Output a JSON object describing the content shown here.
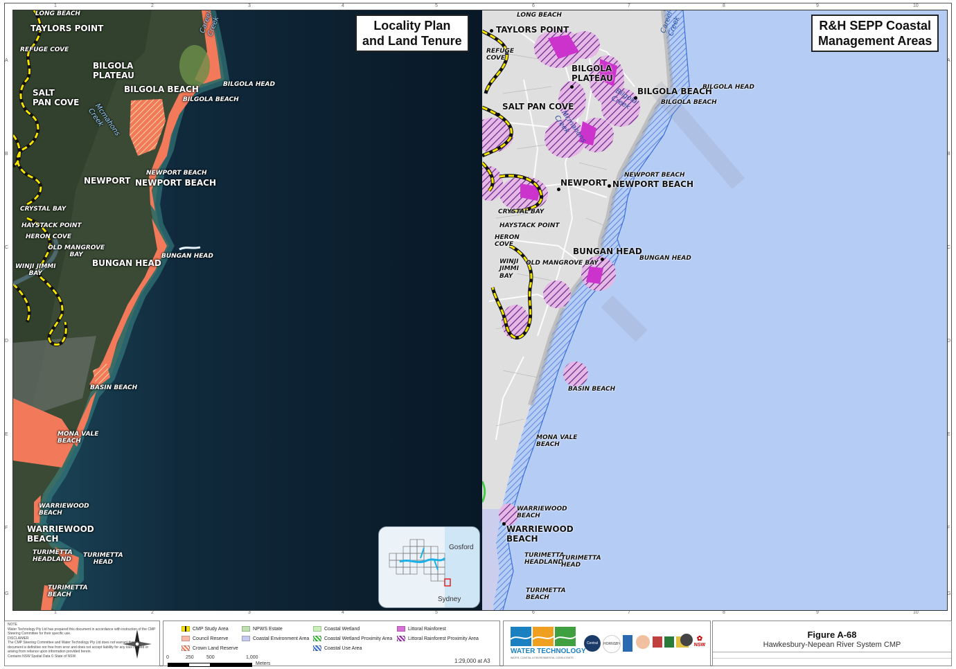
{
  "left_map": {
    "title_line1": "Locality Plan",
    "title_line2": "and Land Tenure",
    "labels": {
      "long_beach": "LONG BEACH",
      "taylors_point": "TAYLORS POINT",
      "refuge_cove": "REFUGE COVE",
      "bilgola_plateau_1": "BILGOLA",
      "bilgola_plateau_2": "PLATEAU",
      "bilgola_beach_big": "BILGOLA BEACH",
      "bilgola_head": "BILGOLA HEAD",
      "bilgola_beach_small": "BILGOLA BEACH",
      "salt_1": "SALT",
      "salt_2": "PAN COVE",
      "mcmahons_1": "Mcmahons",
      "mcmahons_2": "Creek",
      "careel_1": "Careel",
      "careel_2": "Creek",
      "newport_beach_small": "NEWPORT BEACH",
      "newport": "NEWPORT",
      "newport_beach_big": "NEWPORT BEACH",
      "crystal_bay": "CRYSTAL BAY",
      "haystack_point": "HAYSTACK POINT",
      "heron_cove": "HERON COVE",
      "old_mangrove_1": "OLD MANGROVE",
      "old_mangrove_2": "BAY",
      "winji_1": "WINJI JIMMI",
      "winji_2": "BAY",
      "bungan_head_big": "BUNGAN HEAD",
      "bungan_head_small": "BUNGAN HEAD",
      "basin_beach": "BASIN BEACH",
      "mona_vale_1": "MONA VALE",
      "mona_vale_2": "BEACH",
      "warriewood_small_1": "WARRIEWOOD",
      "warriewood_small_2": "BEACH",
      "warriewood_big_1": "WARRIEWOOD",
      "warriewood_big_2": "BEACH",
      "turimetta_headland_1": "TURIMETTA",
      "turimetta_headland_2": "HEADLAND",
      "turimetta_head_1": "TURIMETTA",
      "turimetta_head_2": "HEAD",
      "turimetta_beach_1": "TURIMETTA",
      "turimetta_beach_2": "BEACH"
    },
    "inset": {
      "gosford": "Gosford",
      "sydney": "Sydney"
    }
  },
  "right_map": {
    "title_line1": "R&H SEPP Coastal",
    "title_line2": "Management Areas",
    "labels": {
      "long_beach": "LONG BEACH",
      "taylors_point": "TAYLORS POINT",
      "refuge_1": "REFUGE",
      "refuge_2": "COVE",
      "bilgola_plateau_1": "BILGOLA",
      "bilgola_plateau_2": "PLATEAU",
      "bilgola_beach_big": "BILGOLA BEACH",
      "bilgola_head": "BILGOLA HEAD",
      "bilgola_beach_small": "BILGOLA BEACH",
      "salt_pan_cove": "SALT PAN COVE",
      "mcmahons_1": "Mcmahons",
      "mcmahons_2": "Creek",
      "bilgola_creek_1": "Bilgola",
      "bilgola_creek_2": "Creek",
      "careel_1": "Careel",
      "careel_2": "Creek",
      "newport": "NEWPORT",
      "newport_beach_big": "NEWPORT BEACH",
      "newport_beach_small": "NEWPORT BEACH",
      "crystal_bay": "CRYSTAL BAY",
      "haystack_point": "HAYSTACK POINT",
      "heron_1": "HERON",
      "heron_2": "COVE",
      "winji_1": "WINJI",
      "winji_2": "JIMMI",
      "winji_3": "BAY",
      "old_mangrove_bay": "OLD MANGROVE BAY",
      "bungan_head_big": "BUNGAN HEAD",
      "bungan_head_small": "BUNGAN HEAD",
      "basin_beach": "BASIN BEACH",
      "mona_vale_1": "MONA VALE",
      "mona_vale_2": "BEACH",
      "warriewood_small_1": "WARRIEWOOD",
      "warriewood_small_2": "BEACH",
      "warriewood_big_1": "WARRIEWOOD",
      "warriewood_big_2": "BEACH",
      "turimetta_headland_1": "TURIMETTA",
      "turimetta_headland_2": "HEADLAND",
      "turimetta_head_1": "TURIMETTA",
      "turimetta_head_2": "HEAD",
      "turimetta_beach_1": "TURIMETTA",
      "turimetta_beach_2": "BEACH"
    }
  },
  "ruler": {
    "top": [
      "1",
      "2",
      "3",
      "4",
      "5",
      "6",
      "7",
      "8",
      "9",
      "10"
    ],
    "side": [
      "A",
      "B",
      "C",
      "D",
      "E",
      "F",
      "G"
    ]
  },
  "notes": {
    "note_title": "NOTE",
    "note_text": "Water Technology Pty Ltd has prepared this document in accordance with instruction of the CMP Steering Committee for their specific use.",
    "disclaimer_title": "DISCLAIMER",
    "disclaimer_text": "The CMP Steering Committee and Water Technology Pty Ltd does not warrant that this document is definitive nor free from error and does not accept liability for any loss caused or arising from reliance upon information provided herein.",
    "copyright": "Contains NSW Spatial Data © State of NSW"
  },
  "legend": {
    "items": [
      {
        "label": "CMP Study Area",
        "swatch": "yellow-dash"
      },
      {
        "label": "Council Reserve",
        "swatch": "salmon"
      },
      {
        "label": "Crown Land Reserve",
        "swatch": "orange-hatch"
      },
      {
        "label": "NPWS Estate",
        "swatch": "lightgreen"
      },
      {
        "label": "Coastal Environment Area",
        "swatch": "lavender"
      },
      {
        "label": "Coastal Wetland",
        "swatch": "green"
      },
      {
        "label": "Coastal Wetland Proximity Area",
        "swatch": "green-hatch"
      },
      {
        "label": "Coastal Use Area",
        "swatch": "blue-hatch"
      },
      {
        "label": "Littoral Rainforest",
        "swatch": "magenta"
      },
      {
        "label": "Littoral Rainforest Proximity Area",
        "swatch": "magenta-hatch"
      }
    ],
    "scale_ticks": [
      "0",
      "250",
      "500",
      "1,000"
    ],
    "scale_unit": "Meters",
    "scale_ratio": "1:29,000 at A3"
  },
  "logos": {
    "water_tech_1": "WATER TECHNOLOGY",
    "water_tech_2": "WATER, COASTAL & ENVIRONMENTAL CONSULTANTS",
    "central_coast": "Central Coast Council",
    "hornsby": "HORNSBY",
    "nsw": "NSW"
  },
  "figure": {
    "title": "Figure A-68",
    "subtitle": "Hawkesbury-Nepean River System CMP"
  },
  "colors": {
    "ocean_left": "#0b1d2c",
    "ocean_right": "#b5ccf5",
    "council_reserve": "#f2795a",
    "study_area": "#f5e400",
    "littoral_rainforest": "#cc33cc",
    "coastal_use": "#3b6fd8"
  }
}
